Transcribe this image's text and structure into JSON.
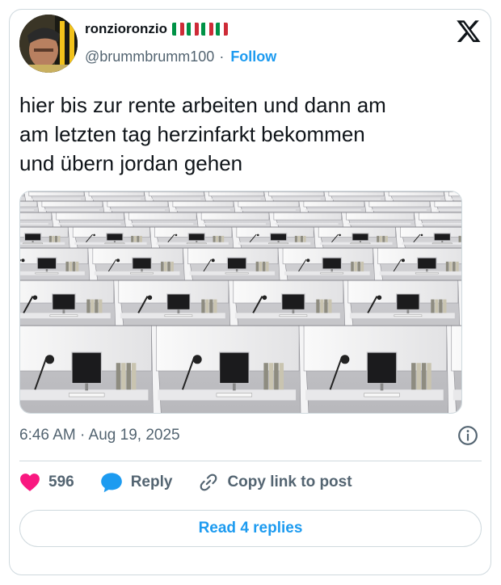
{
  "author": {
    "name": "ronzioronzio",
    "handle": "@brummbrumm100",
    "follow_label": "Follow",
    "flag_colors": [
      "#009246",
      "#ffffff",
      "#ce2b37"
    ]
  },
  "tweet": {
    "text": "hier bis zur rente arbeiten und dann am\nam letzten tag herzinfarkt bekommen\nund übern jordan gehen",
    "timestamp": "6:46 AM · Aug 19, 2025"
  },
  "actions": {
    "likes": "596",
    "reply_label": "Reply",
    "copy_label": "Copy link to post",
    "read_replies": "Read 4 replies"
  },
  "colors": {
    "accent": "#1d9bf0",
    "like": "#f91880",
    "secondary_text": "#536471",
    "border": "#cfd9de"
  },
  "icons": [
    "x-logo-icon",
    "info-icon",
    "heart-icon",
    "reply-bubble-icon",
    "link-icon"
  ]
}
